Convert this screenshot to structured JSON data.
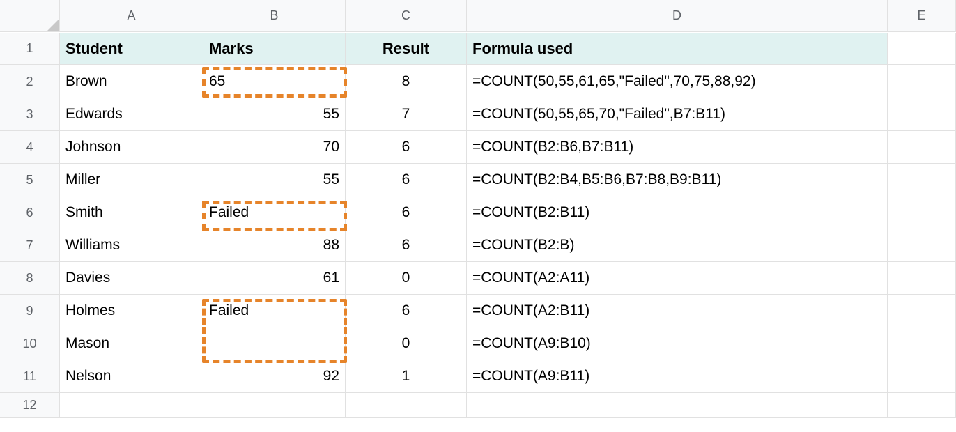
{
  "columns": [
    "A",
    "B",
    "C",
    "D",
    "E"
  ],
  "row_numbers": [
    "1",
    "2",
    "3",
    "4",
    "5",
    "6",
    "7",
    "8",
    "9",
    "10",
    "11",
    "12"
  ],
  "headers": {
    "A": "Student",
    "B": "Marks",
    "C": "Result",
    "D": "Formula used",
    "E": ""
  },
  "rows": [
    {
      "student": "Brown",
      "marks": "65",
      "result": "8",
      "formula": "=COUNT(50,55,61,65,\"Failed\",70,75,88,92)",
      "marks_align": "left"
    },
    {
      "student": "Edwards",
      "marks": "55",
      "result": "7",
      "formula": "=COUNT(50,55,65,70,\"Failed\",B7:B11)",
      "marks_align": "right"
    },
    {
      "student": "Johnson",
      "marks": "70",
      "result": "6",
      "formula": "=COUNT(B2:B6,B7:B11)",
      "marks_align": "right"
    },
    {
      "student": "Miller",
      "marks": "55",
      "result": "6",
      "formula": "=COUNT(B2:B4,B5:B6,B7:B8,B9:B11)",
      "marks_align": "right"
    },
    {
      "student": "Smith",
      "marks": "Failed",
      "result": "6",
      "formula": "=COUNT(B2:B11)",
      "marks_align": "left"
    },
    {
      "student": "Williams",
      "marks": "88",
      "result": "6",
      "formula": "=COUNT(B2:B)",
      "marks_align": "right"
    },
    {
      "student": "Davies",
      "marks": "61",
      "result": "0",
      "formula": "=COUNT(A2:A11)",
      "marks_align": "right"
    },
    {
      "student": "Holmes",
      "marks": "Failed",
      "result": "6",
      "formula": "=COUNT(A2:B11)",
      "marks_align": "left"
    },
    {
      "student": "Mason",
      "marks": "",
      "result": "0",
      "formula": "=COUNT(A9:B10)",
      "marks_align": "left"
    },
    {
      "student": "Nelson",
      "marks": "92",
      "result": "1",
      "formula": "=COUNT(A9:B11)",
      "marks_align": "right"
    }
  ],
  "highlight_color": "#E6842A"
}
